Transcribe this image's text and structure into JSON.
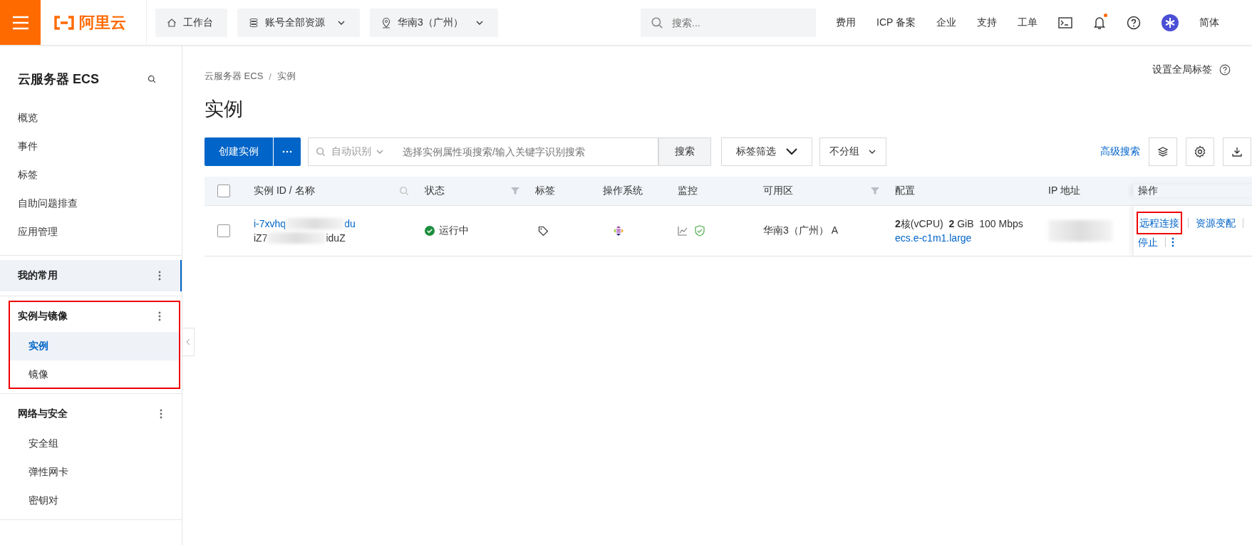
{
  "topbar": {
    "logo": "阿里云",
    "nav": [
      {
        "kind": "home",
        "label": "工作台"
      },
      {
        "kind": "resources",
        "label": "账号全部资源"
      },
      {
        "kind": "region",
        "label": "华南3（广州）"
      }
    ],
    "search": {
      "placeholder": "搜索..."
    },
    "links": [
      "费用",
      "ICP 备案",
      "企业",
      "支持",
      "工单"
    ],
    "has_unread": true,
    "language": "简体"
  },
  "sidebar": {
    "title": "云服务器 ECS",
    "items": [
      "概览",
      "事件",
      "标签",
      "自助问题排查",
      "应用管理"
    ],
    "groups": [
      {
        "title": "我的常用",
        "selected": true,
        "annotated": false
      },
      {
        "title": "实例与镜像",
        "selected": false,
        "annotated": true,
        "children": [
          {
            "label": "实例",
            "selected": true
          },
          {
            "label": "镜像",
            "selected": false
          }
        ]
      },
      {
        "title": "网络与安全",
        "selected": false,
        "annotated": false,
        "children": [
          {
            "label": "安全组",
            "selected": false
          },
          {
            "label": "弹性网卡",
            "selected": false
          },
          {
            "label": "密钥对",
            "selected": false
          }
        ]
      }
    ]
  },
  "breadcrumb": [
    "云服务器 ECS",
    "实例"
  ],
  "breadcrumb_separator": "/",
  "global_tag": "设置全局标签",
  "title": "实例",
  "toolbar": {
    "create": "创建实例",
    "search_mode": "自动识别",
    "search_placeholder": "选择实例属性项搜索/输入关键字识别搜索",
    "search_button": "搜索",
    "tag_filter": "标签筛选",
    "grouping": "不分组",
    "advanced": "高级搜索"
  },
  "table": {
    "all_checked": false,
    "columns": [
      {
        "label": "实例 ID / 名称",
        "kind": "search"
      },
      {
        "label": "状态",
        "kind": "filter"
      },
      {
        "label": "标签",
        "kind": "plain"
      },
      {
        "label": "操作系统",
        "kind": "plain"
      },
      {
        "label": "监控",
        "kind": "plain"
      },
      {
        "label": "可用区",
        "kind": "filter"
      },
      {
        "label": "配置",
        "kind": "plain"
      },
      {
        "label": "IP 地址",
        "kind": "plain"
      },
      {
        "label": "操作",
        "kind": "plain"
      }
    ],
    "rows": [
      {
        "checked": false,
        "id_start": "i-7xvhq",
        "id_end": "du",
        "name_start": "iZ7",
        "name_end": "iduZ",
        "status": "运行中",
        "zone": "华南3（广州） A",
        "config": "**2**核(vCPU)  **2** GiB  100 Mbps",
        "type": "ecs.e-c1m1.large",
        "actions": [
          {
            "label": "远程连接",
            "annotated": true
          },
          {
            "label": "资源变配",
            "annotated": false
          },
          {
            "label": "停止",
            "annotated": false
          }
        ]
      }
    ]
  }
}
